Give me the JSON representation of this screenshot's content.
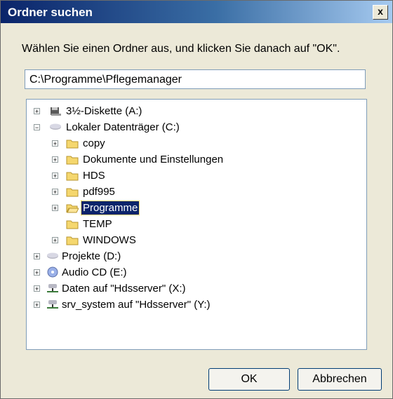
{
  "window": {
    "title": "Ordner suchen",
    "close_label": "x"
  },
  "prompt": "Wählen Sie einen Ordner aus, und klicken Sie danach auf \"OK\".",
  "path_field": {
    "value": "C:\\Programme\\Pflegemanager"
  },
  "tree": {
    "items": [
      {
        "label": "3½-Diskette (A:)",
        "icon": "floppy-drive-icon",
        "expander": "+"
      },
      {
        "label": "Lokaler Datenträger (C:)",
        "icon": "hard-drive-icon",
        "expander": "−"
      },
      {
        "label": "copy",
        "icon": "folder-icon",
        "expander": "+"
      },
      {
        "label": "Dokumente und Einstellungen",
        "icon": "folder-icon",
        "expander": "+"
      },
      {
        "label": "HDS",
        "icon": "folder-icon",
        "expander": "+"
      },
      {
        "label": "pdf995",
        "icon": "folder-icon",
        "expander": "+"
      },
      {
        "label": "Programme",
        "icon": "open-folder-icon",
        "expander": "+",
        "selected": true
      },
      {
        "label": "TEMP",
        "icon": "folder-icon",
        "expander": ""
      },
      {
        "label": "WINDOWS",
        "icon": "folder-icon",
        "expander": "+"
      },
      {
        "label": "Projekte (D:)",
        "icon": "hard-drive-icon",
        "expander": "+"
      },
      {
        "label": "Audio CD (E:)",
        "icon": "cd-drive-icon",
        "expander": "+"
      },
      {
        "label": "Daten auf \"Hdsserver\" (X:)",
        "icon": "network-drive-icon",
        "expander": "+"
      },
      {
        "label": "srv_system auf \"Hdsserver\" (Y:)",
        "icon": "network-drive-icon",
        "expander": "+"
      }
    ]
  },
  "buttons": {
    "ok": "OK",
    "cancel": "Abbrechen"
  },
  "colors": {
    "title_bar": "#0a246a",
    "selection": "#0a246a",
    "folder": "#f5d76e"
  }
}
